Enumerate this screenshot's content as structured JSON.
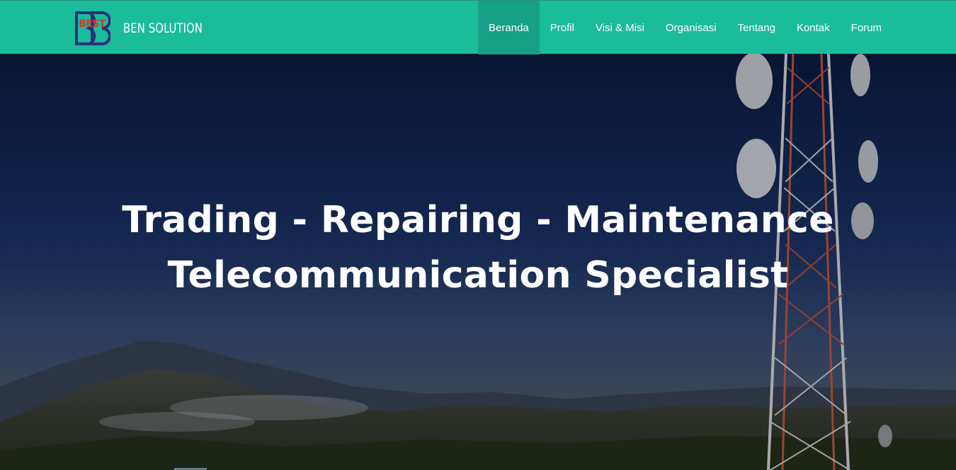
{
  "header": {
    "logo_text": "BEST",
    "brand_name": "BEN SOLUTION",
    "colors": {
      "bar": "#1abc9c",
      "active": "#16a085",
      "text": "#ffffff"
    }
  },
  "nav": {
    "items": [
      {
        "label": "Beranda",
        "active": true
      },
      {
        "label": "Profil",
        "active": false
      },
      {
        "label": "Visi & Misi",
        "active": false
      },
      {
        "label": "Organisasi",
        "active": false
      },
      {
        "label": "Tentang",
        "active": false
      },
      {
        "label": "Kontak",
        "active": false
      },
      {
        "label": "Forum",
        "active": false
      }
    ]
  },
  "hero": {
    "line1": "Trading - Repairing - Maintenance",
    "line2": "Telecommunication Specialist",
    "background": "telecom-tower-mountain-photo"
  }
}
